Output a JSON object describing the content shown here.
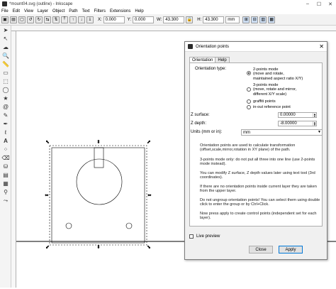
{
  "window": {
    "title": "*mount04.svg (outline) - Inkscape",
    "controls": [
      "–",
      "☐",
      "✕"
    ]
  },
  "menu": [
    "File",
    "Edit",
    "View",
    "Layer",
    "Object",
    "Path",
    "Text",
    "Filters",
    "Extensions",
    "Help"
  ],
  "toolbar": {
    "x_label": "X:",
    "x_value": "0.000",
    "y_label": "Y:",
    "y_value": "0.000",
    "w_label": "W:",
    "w_value": "43.300",
    "h_label": "H:",
    "h_value": "43.300",
    "unit": "mm"
  },
  "tools": [
    "select-icon",
    "node-icon",
    "tweak-icon",
    "zoom-icon",
    "measure-icon",
    "rect-icon",
    "box3d-icon",
    "ellipse-icon",
    "star-icon",
    "spiral-icon",
    "pencil-icon",
    "pen-icon",
    "calligraphy-icon",
    "text-icon",
    "spray-icon",
    "eraser-icon",
    "bucket-icon",
    "gradient-icon",
    "mesh-icon",
    "dropper-icon",
    "connector-icon"
  ],
  "dialog": {
    "title": "Orientation points",
    "close_label": "✕",
    "tabs": [
      "Orientation",
      "Help"
    ],
    "orientation_type_label": "Orientation type:",
    "options": [
      "2-points mode\n(move and rotate,\nmaintained aspect ratio X/Y)",
      "3-points mode\n(move, rotate and mirror,\ndifferent X/Y scale)",
      "graffiti points",
      "in-out reference point"
    ],
    "selected_option": 0,
    "z_surface_label": "Z surface:",
    "z_surface_value": "0.00000",
    "z_depth_label": "Z depth:",
    "z_depth_value": "-8.00000",
    "units_label": "Units (mm or in):",
    "units_value": "mm",
    "info": [
      "Orientation points are used to calculate transformation (offset,scale,mirror,rotation in XY plane) of the path.",
      "3-points mode only: do not put all three into one line (use 2-points mode instead).",
      "You can modify Z surface, Z depth values later using text tool (3rd coordinates).",
      "If there are no orientation points inside current layer they are taken from the upper layer.",
      "Do not ungroup orientation points! You can select them using double click to enter the group or by Ctrl+Click.",
      "Now press apply to create control points (independent set for each layer)."
    ],
    "live_preview_label": "Live preview",
    "close_button": "Close",
    "apply_button": "Apply"
  }
}
